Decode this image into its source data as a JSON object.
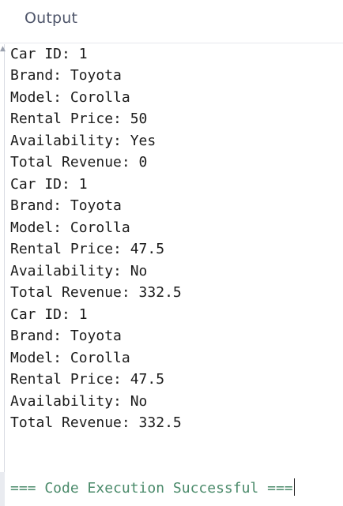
{
  "panel": {
    "title": "Output"
  },
  "output": {
    "lines": [
      "Car ID: 1",
      "Brand: Toyota",
      "Model: Corolla",
      "Rental Price: 50",
      "Availability: Yes",
      "Total Revenue: 0",
      "Car ID: 1",
      "Brand: Toyota",
      "Model: Corolla",
      "Rental Price: 47.5",
      "Availability: No",
      "Total Revenue: 332.5",
      "Car ID: 1",
      "Brand: Toyota",
      "Model: Corolla",
      "Rental Price: 47.5",
      "Availability: No",
      "Total Revenue: 332.5"
    ],
    "status": "=== Code Execution Successful ==="
  }
}
